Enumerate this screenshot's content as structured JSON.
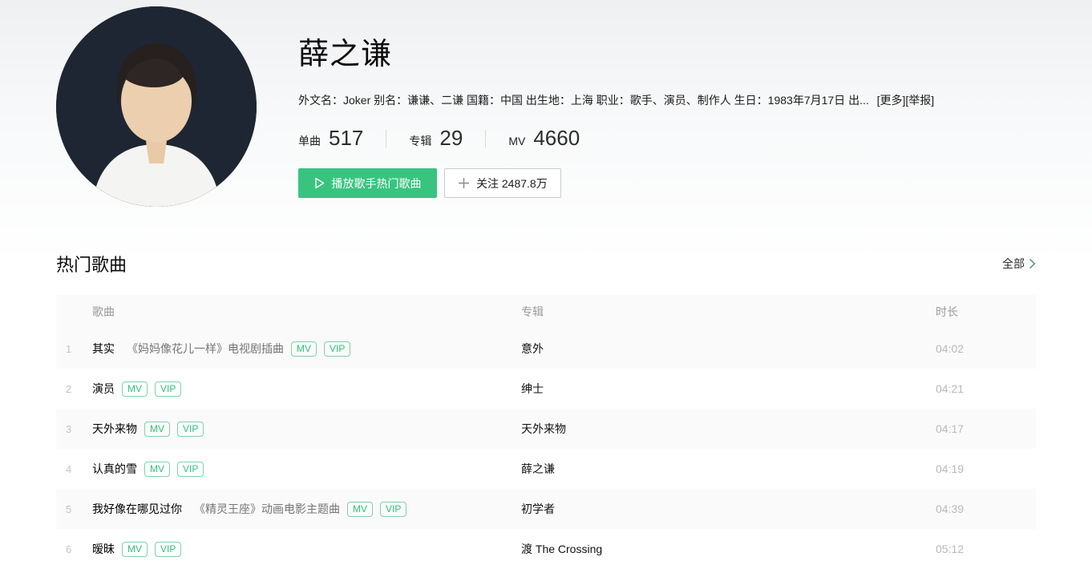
{
  "colors": {
    "accent_green": "#38c47f",
    "badge_green": "#31c27c",
    "row_stripe": "#fafafa",
    "duration_gray": "#b9b9b9"
  },
  "artist": {
    "name": "薛之谦",
    "info": "外文名：Joker 别名：谦谦、二谦 国籍：中国 出生地：上海 职业：歌手、演员、制作人 生日：1983年7月17日 出...",
    "more_label": "[更多]",
    "report_label": "[举报]",
    "stats": [
      {
        "label": "单曲",
        "value": "517"
      },
      {
        "label": "专辑",
        "value": "29"
      },
      {
        "label": "MV",
        "value": "4660"
      }
    ],
    "play_button_label": "播放歌手热门歌曲",
    "follow_button_label": "关注 2487.8万",
    "avatar_description": "artist-photo-dark-background"
  },
  "hot_songs": {
    "title": "热门歌曲",
    "all_label": "全部",
    "columns": {
      "song": "歌曲",
      "album": "专辑",
      "duration": "时长"
    },
    "rows": [
      {
        "index": "1",
        "name": "其实",
        "subtitle": "《妈妈像花儿一样》电视剧插曲",
        "badges": [
          "MV",
          "VIP"
        ],
        "album": "意外",
        "duration": "04:02"
      },
      {
        "index": "2",
        "name": "演员",
        "subtitle": "",
        "badges": [
          "MV",
          "VIP"
        ],
        "album": "绅士",
        "duration": "04:21"
      },
      {
        "index": "3",
        "name": "天外来物",
        "subtitle": "",
        "badges": [
          "MV",
          "VIP"
        ],
        "album": "天外来物",
        "duration": "04:17"
      },
      {
        "index": "4",
        "name": "认真的雪",
        "subtitle": "",
        "badges": [
          "MV",
          "VIP"
        ],
        "album": "薛之谦",
        "duration": "04:19"
      },
      {
        "index": "5",
        "name": "我好像在哪见过你",
        "subtitle": "《精灵王座》动画电影主题曲",
        "badges": [
          "MV",
          "VIP"
        ],
        "album": "初学者",
        "duration": "04:39"
      },
      {
        "index": "6",
        "name": "暧昧",
        "subtitle": "",
        "badges": [
          "MV",
          "VIP"
        ],
        "album": "渡 The Crossing",
        "duration": "05:12"
      }
    ]
  }
}
